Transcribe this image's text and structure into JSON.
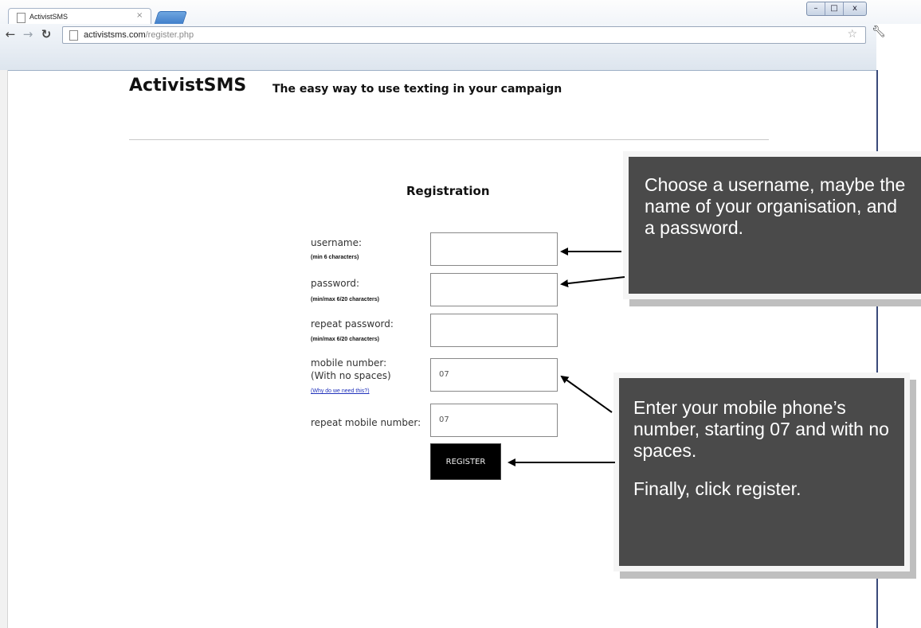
{
  "browser": {
    "tab_title": "ActivistSMS",
    "tab_close": "×",
    "url_domain": "activistsms.com",
    "url_path": "/register.php",
    "window_buttons": {
      "minimize": "–",
      "maximize": "□",
      "close": "x"
    },
    "nav_icons": [
      "back-arrow-icon",
      "forward-arrow-icon",
      "reload-icon",
      "bookmark-star-icon",
      "wrench-icon"
    ]
  },
  "page": {
    "brand": "ActivistSMS",
    "tagline": "The easy way to use texting in your campaign",
    "heading": "Registration",
    "form": {
      "username_label": "username:",
      "username_hint": "(min 6 characters)",
      "username_value": "",
      "password_label": "password:",
      "password_hint": "(min/max 6/20 characters)",
      "password_value": "",
      "repeat_password_label": "repeat password:",
      "repeat_password_hint": "(min/max 6/20 characters)",
      "repeat_password_value": "",
      "mobile_label": "mobile number:",
      "mobile_sublabel": "(With no spaces)",
      "mobile_link": "(Why do we need this?)",
      "mobile_value": "07",
      "repeat_mobile_label": "repeat mobile number:",
      "repeat_mobile_value": "07",
      "register_button": "REGISTER"
    }
  },
  "callouts": {
    "first": "Choose a username, maybe the name of your organisation, and a password.",
    "second_line1": "Enter your mobile phone’s number, starting 07 and with no spaces.",
    "second_line2": "Finally, click register."
  },
  "colors": {
    "callout_bg": "#4a4a4a",
    "button_bg": "#000000",
    "link": "#2233bb"
  }
}
